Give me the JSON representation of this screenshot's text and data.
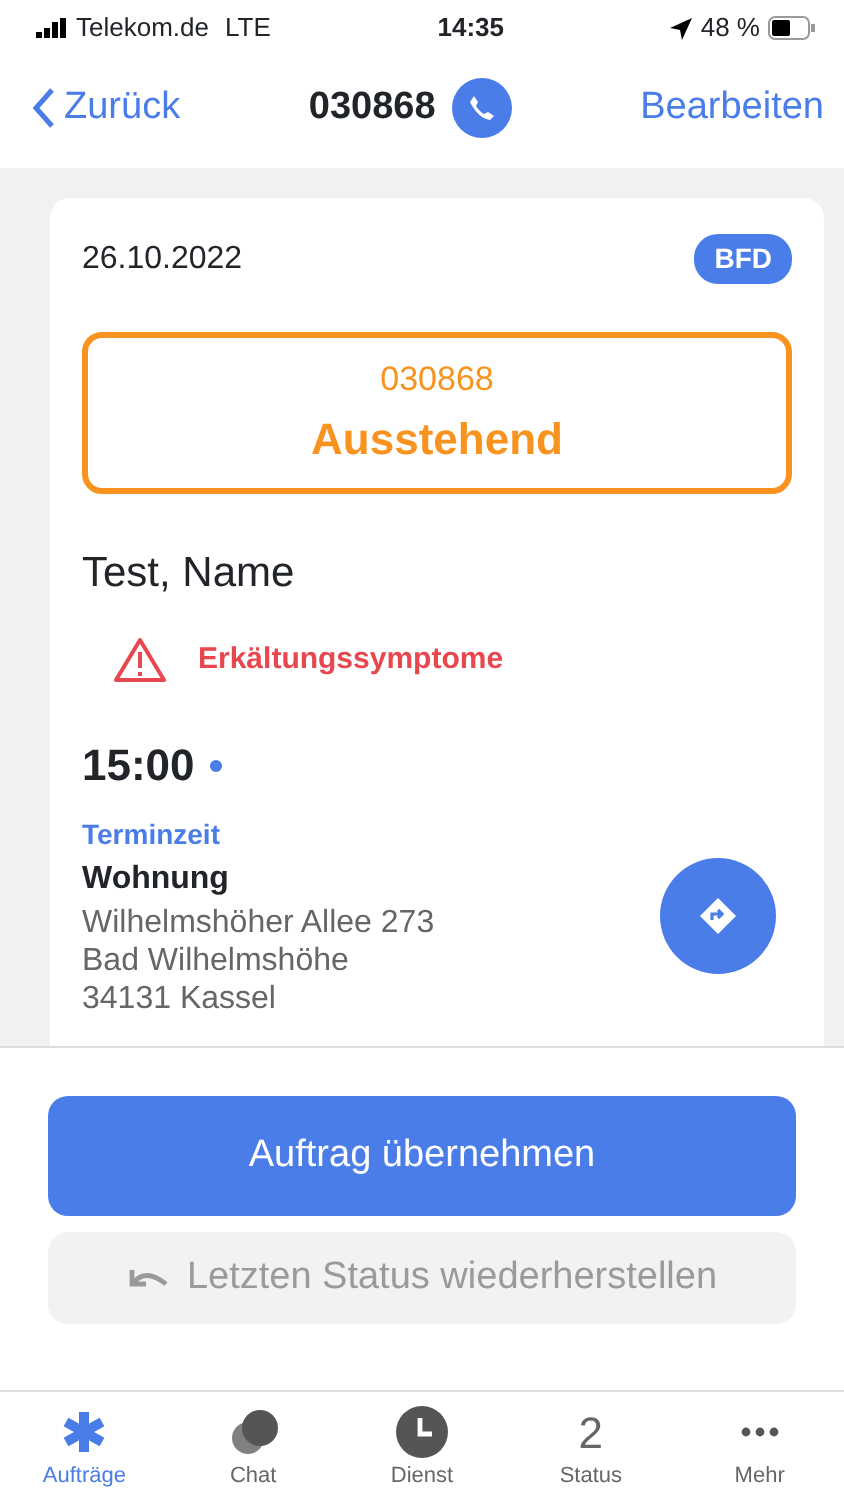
{
  "status_bar": {
    "carrier": "Telekom.de",
    "network": "LTE",
    "time": "14:35",
    "battery": "48 %"
  },
  "nav": {
    "back": "Zurück",
    "title": "030868",
    "action": "Bearbeiten"
  },
  "card": {
    "date": "26.10.2022",
    "badge": "BFD",
    "order_number": "030868",
    "status": "Ausstehend",
    "name": "Test, Name",
    "warning": "Erkältungssymptome",
    "time": "15:00",
    "time_label": "Terminzeit",
    "place": "Wohnung",
    "address": [
      "Wilhelmshöher Allee 273",
      "Bad Wilhelmshöhe",
      "34131 Kassel"
    ]
  },
  "buttons": [
    {
      "label": "Auftrag übernehmen",
      "kind": "primary",
      "disabled": false
    },
    {
      "label": "Letzten Status wiederherstellen",
      "kind": "restore",
      "disabled": true
    }
  ],
  "tabs": [
    {
      "label": "Aufträge",
      "kind": "asterisk",
      "selected": true
    },
    {
      "label": "Chat",
      "kind": "chat",
      "selected": false
    },
    {
      "label": "Dienst",
      "kind": "clock",
      "selected": false
    },
    {
      "label": "Status",
      "kind": "number",
      "value": "2",
      "selected": false
    },
    {
      "label": "Mehr",
      "kind": "more",
      "selected": false
    }
  ]
}
